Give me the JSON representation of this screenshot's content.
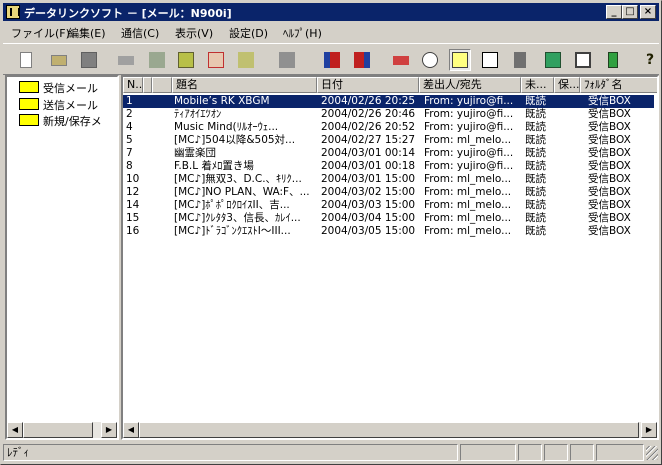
{
  "window": {
    "title": "データリンクソフト － [メール：N900i]"
  },
  "menu": [
    {
      "label": "ファイル(F)"
    },
    {
      "label": "編集(E)"
    },
    {
      "label": "通信(C)"
    },
    {
      "label": "表示(V)"
    },
    {
      "label": "設定(D)"
    },
    {
      "label": "ﾍﾙﾌﾟ(H)"
    }
  ],
  "toolbar": {
    "icons": [
      "new-icon",
      "open-icon",
      "save-icon",
      "print-icon",
      "copy-icon",
      "import-icon",
      "delete-icon",
      "send-icon",
      "reply-icon",
      "receive-icon",
      "send-phone-icon",
      "backup-icon",
      "settings-icon",
      "mail-icon",
      "memo-icon",
      "phonebook-icon",
      "image-icon",
      "schedule-icon",
      "phone-icon",
      "help-icon"
    ],
    "help_glyph": "?"
  },
  "tree": {
    "items": [
      {
        "label": "受信メール"
      },
      {
        "label": "送信メール"
      },
      {
        "label": "新規/保存メ"
      }
    ]
  },
  "list": {
    "columns": [
      "N..",
      "",
      "題名",
      "日付",
      "差出人/宛先",
      "未...",
      "保...",
      "ﾌｫﾙﾀﾞ名"
    ],
    "rows": [
      {
        "n": "1",
        "subject": "Mobile’s RK XBGM",
        "date": "2004/02/26 20:25",
        "from": "From: yujiro@fi...",
        "status": "既読",
        "folder": "受信BOX",
        "selected": true
      },
      {
        "n": "2",
        "subject": "ﾃｨｱｵｲｴﾂｵﾝ",
        "date": "2004/02/26 20:46",
        "from": "From: yujiro@fi...",
        "status": "既読",
        "folder": "受信BOX"
      },
      {
        "n": "4",
        "subject": "Music Mind(ﾘﾙｵｰｳｪ...",
        "date": "2004/02/26 20:52",
        "from": "From: yujiro@fi...",
        "status": "既読",
        "folder": "受信BOX"
      },
      {
        "n": "5",
        "subject": "[MC♪]504以降&505対...",
        "date": "2004/02/27 15:27",
        "from": "From: ml_melo...",
        "status": "既読",
        "folder": "受信BOX"
      },
      {
        "n": "7",
        "subject": "幽霊楽団",
        "date": "2004/03/01 00:14",
        "from": "From: yujiro@fi...",
        "status": "既読",
        "folder": "受信BOX"
      },
      {
        "n": "8",
        "subject": "F.B.L 着ﾒﾛ置き場",
        "date": "2004/03/01 00:18",
        "from": "From: yujiro@fi...",
        "status": "既読",
        "folder": "受信BOX"
      },
      {
        "n": "10",
        "subject": "[MC♪]無双3、D.C.、ｷﾘｸ...",
        "date": "2004/03/01 15:00",
        "from": "From: ml_melo...",
        "status": "既読",
        "folder": "受信BOX"
      },
      {
        "n": "12",
        "subject": "[MC♪]NO PLAN、WA:F、...",
        "date": "2004/03/02 15:00",
        "from": "From: ml_melo...",
        "status": "既読",
        "folder": "受信BOX"
      },
      {
        "n": "14",
        "subject": "[MC♪]ﾎﾟﾎﾟﾛｸﾛｲｽII、吉...",
        "date": "2004/03/03 15:00",
        "from": "From: ml_melo...",
        "status": "既読",
        "folder": "受信BOX"
      },
      {
        "n": "15",
        "subject": "[MC♪]ｸﾚﾀﾀ3、信長、ｶﾚｲ...",
        "date": "2004/03/04 15:00",
        "from": "From: ml_melo...",
        "status": "既読",
        "folder": "受信BOX"
      },
      {
        "n": "16",
        "subject": "[MC♪]ﾄﾞﾗｺﾞﾝｸｴｽﾄI～III...",
        "date": "2004/03/05 15:00",
        "from": "From: ml_melo...",
        "status": "既読",
        "folder": "受信BOX"
      }
    ]
  },
  "status": {
    "text": "ﾚﾃﾞｨ"
  },
  "colors": {
    "titlebar": "#0a246a",
    "selection": "#0a246a",
    "face": "#d4d0c8",
    "folder": "#ffff00"
  }
}
